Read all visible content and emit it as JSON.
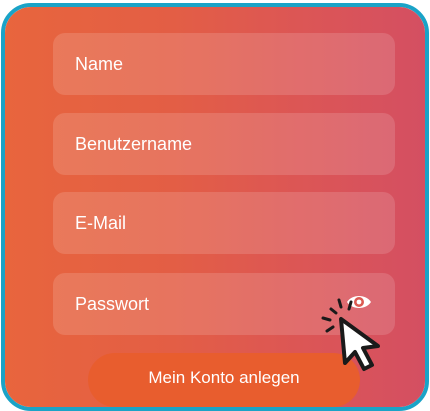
{
  "form": {
    "fields": [
      {
        "placeholder": "Name"
      },
      {
        "placeholder": "Benutzername"
      },
      {
        "placeholder": "E-Mail"
      },
      {
        "placeholder": "Passwort"
      }
    ],
    "password_toggle_icon": "eye-icon",
    "submit_label": "Mein Konto anlegen"
  },
  "overlay": {
    "cursor_icon": "mouse-pointer-click-icon"
  },
  "colors": {
    "frame_border": "#1aa3c7",
    "card_gradient_start": "#e8653d",
    "card_gradient_end": "#d44f62",
    "button": "#e85d2e",
    "text": "#ffffff"
  }
}
